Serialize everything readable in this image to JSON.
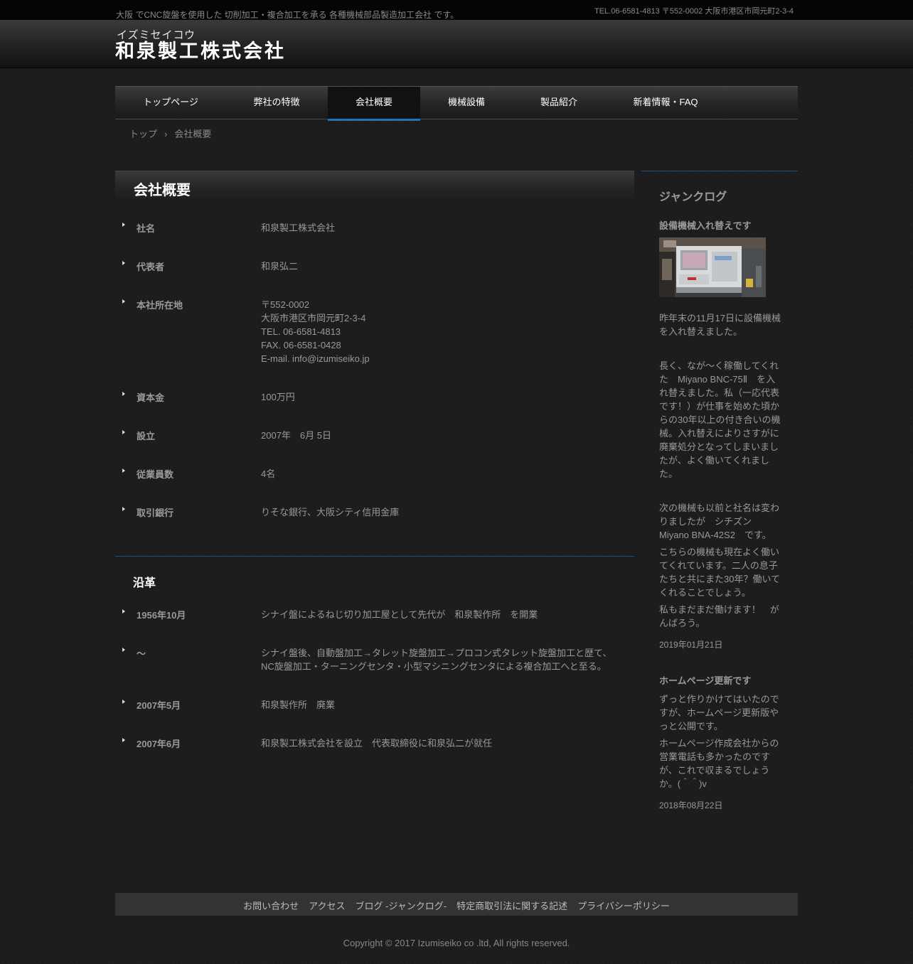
{
  "topbar": {
    "tagline": "大阪 でCNC旋盤を使用した 切削加工・複合加工を承る 各種機械部品製造加工会社 です。",
    "contact": "TEL.06-6581-4813 〒552-0002 大阪市港区市岡元町2-3-4"
  },
  "logo": {
    "kana": "イズミセイコウ",
    "name": "和泉製工株式会社"
  },
  "nav": [
    "トップページ",
    "弊社の特徴",
    "会社概要",
    "機械設備",
    "製品紹介",
    "新着情報・FAQ"
  ],
  "breadcrumb": {
    "home": "トップ",
    "sep": "›",
    "current": "会社概要"
  },
  "main": {
    "title": "会社概要",
    "profile": [
      {
        "label": "社名",
        "lines": [
          "和泉製工株式会社"
        ]
      },
      {
        "label": "代表者",
        "lines": [
          "和泉弘二"
        ]
      },
      {
        "label": "本社所在地",
        "lines": [
          "〒552-0002",
          "大阪市港区市岡元町2-3-4",
          "TEL. 06-6581-4813",
          "FAX. 06-6581-0428",
          "E-mail. info@izumiseiko.jp"
        ]
      },
      {
        "label": "資本金",
        "lines": [
          "100万円"
        ]
      },
      {
        "label": "設立",
        "lines": [
          "2007年　6月 5日"
        ]
      },
      {
        "label": "従業員数",
        "lines": [
          "4名"
        ]
      },
      {
        "label": "取引銀行",
        "lines": [
          "りそな銀行、大阪シティ信用金庫"
        ]
      }
    ],
    "history_title": "沿革",
    "history": [
      {
        "label": "1956年10月",
        "lines": [
          "シナイ盤によるねじ切り加工屋として先代が　和泉製作所　を開業"
        ]
      },
      {
        "label": "～",
        "lines": [
          "シナイ盤後、自動盤加工→タレット旋盤加工→プロコン式タレット旋盤加工と歴て、",
          "NC旋盤加工・ターニングセンタ・小型マシニングセンタによる複合加工へと至る。"
        ]
      },
      {
        "label": "2007年5月",
        "lines": [
          "和泉製作所　廃業"
        ]
      },
      {
        "label": "2007年6月",
        "lines": [
          "和泉製工株式会社を設立　代表取締役に和泉弘二が就任"
        ]
      }
    ]
  },
  "sidebar": {
    "heading": "ジャンクログ",
    "posts": [
      {
        "title": "設備機械入れ替えです",
        "paragraphs": [
          "昨年末の11月17日に設備機械を入れ替えました。",
          "長く、なが～く稼働してくれた　Miyano BNC-75Ⅱ　を入れ替えました。私（一応代表です！）が仕事を始めた頃からの30年以上の付き合いの機械。入れ替えによりさすがに廃棄処分となってしまいましたが、よく働いてくれました。",
          "次の機械も以前と社名は変わりましたが　シチズン Miyano BNA-42S2　です。",
          "こちらの機械も現在よく働いてくれています。二人の息子たちと共にまた30年？働いてくれることでしょう。",
          "私もまだまだ働けます！　がんばろう。"
        ],
        "date": "2019年01月21日"
      },
      {
        "title": "ホームページ更新です",
        "paragraphs": [
          "ずっと作りかけてはいたのですが、ホームページ更新版やっと公開です。",
          "ホームページ作成会社からの営業電話も多かったのですが、これで収まるでしょうか。(＾＾)v"
        ],
        "date": "2018年08月22日"
      }
    ]
  },
  "footer": {
    "links": [
      "お問い合わせ",
      "アクセス",
      "ブログ -ジャンクログ-",
      "特定商取引法に関する記述",
      "プライバシーポリシー"
    ],
    "copyright": "Copyright © 2017 Izumiseiko co .ltd, All rights reserved."
  }
}
